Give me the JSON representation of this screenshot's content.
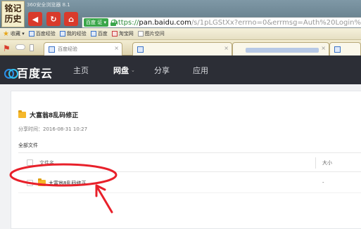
{
  "browser": {
    "logo_line1": "铭记",
    "logo_line2": "历史",
    "title": "360安全浏览器 8.1",
    "cert_label": "百度 证 ▾",
    "url_scheme": "https://",
    "url_domain": "pan.baidu.com",
    "url_path": "/s/1pLGStXx?errno=0&errmsg=Auth%20Login%"
  },
  "favorites": [
    {
      "label": "收藏 ▾",
      "icon": "star-icon"
    },
    {
      "label": "百度经验",
      "icon": "site-icon"
    },
    {
      "label": "我的经验",
      "icon": "site-icon"
    },
    {
      "label": "百度",
      "icon": "site-icon"
    },
    {
      "label": "淘宝网",
      "icon": "taobao-icon"
    },
    {
      "label": "图片空间",
      "icon": "page-icon"
    }
  ],
  "tabs": [
    {
      "label": "百度经验"
    },
    {
      "label": ""
    },
    {
      "label": ""
    },
    {
      "label": ""
    }
  ],
  "header": {
    "logo_text": "百度云",
    "nav": [
      {
        "label": "主页"
      },
      {
        "label": "网盘"
      },
      {
        "label": "分享"
      },
      {
        "label": "应用"
      }
    ]
  },
  "share": {
    "title": "大富翁8乱码修正",
    "time": "分享时间：2016-08-31 10:27",
    "all_files": "全部文件",
    "columns": {
      "name": "文件名",
      "size": "大小"
    },
    "rows": [
      {
        "name": "大富翁8乱码修正",
        "size": "-"
      }
    ]
  },
  "colors": {
    "header_bg": "#2c2e36",
    "annotation_red": "#e8202a",
    "folder_yellow": "#f5b72a"
  }
}
